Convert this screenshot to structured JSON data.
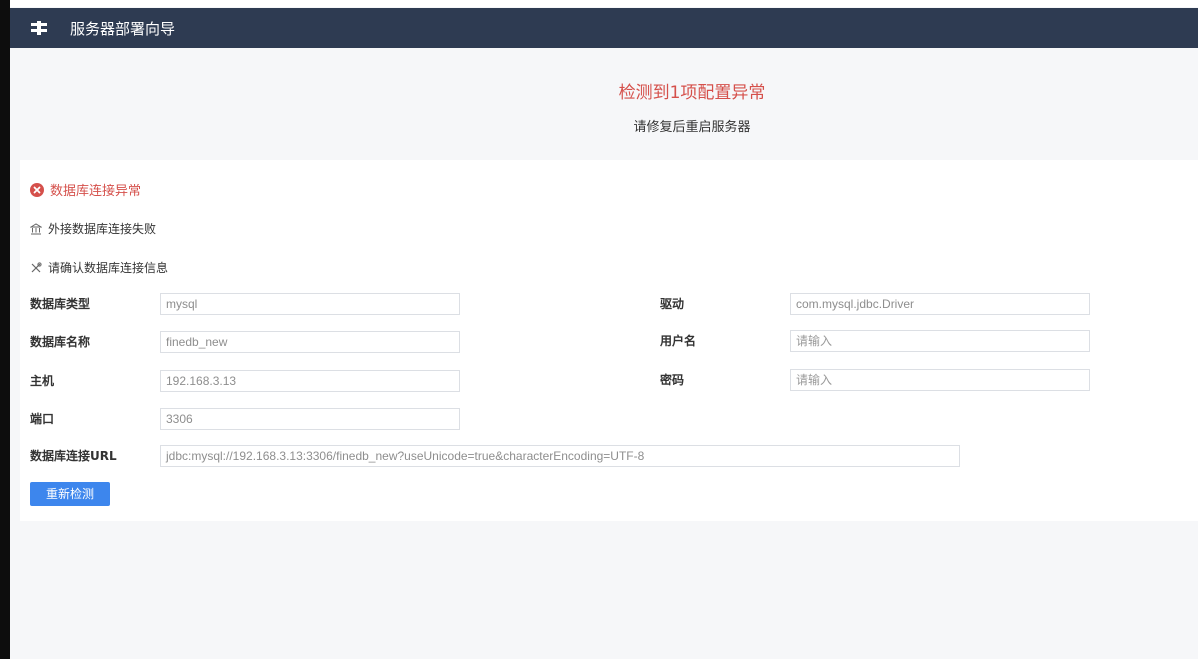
{
  "header": {
    "icon": "wrench-icon",
    "title": "服务器部署向导"
  },
  "summary": {
    "title": "检测到1项配置异常",
    "subtitle": "请修复后重启服务器",
    "accent_color": "#d5504b"
  },
  "error": {
    "icon": "error-circle-icon",
    "title": "数据库连接异常",
    "detail": "外接数据库连接失败",
    "hint": "请确认数据库连接信息"
  },
  "form": {
    "db_type": {
      "label": "数据库类型",
      "value": "mysql"
    },
    "db_name": {
      "label": "数据库名称",
      "value": "finedb_new"
    },
    "host": {
      "label": "主机",
      "value": "192.168.3.13"
    },
    "port": {
      "label": "端口",
      "value": "3306"
    },
    "url": {
      "label": "数据库连接URL",
      "value": "jdbc:mysql://192.168.3.13:3306/finedb_new?useUnicode=true&characterEncoding=UTF-8"
    },
    "driver": {
      "label": "驱动",
      "value": "com.mysql.jdbc.Driver"
    },
    "username": {
      "label": "用户名",
      "placeholder": "请输入"
    },
    "password": {
      "label": "密码",
      "placeholder": "请输入"
    }
  },
  "recheck_button": {
    "label": "重新检测",
    "color": "#3d86ed"
  },
  "colors": {
    "header_bg": "#2e3b52",
    "page_bg": "#f6f7f9"
  }
}
